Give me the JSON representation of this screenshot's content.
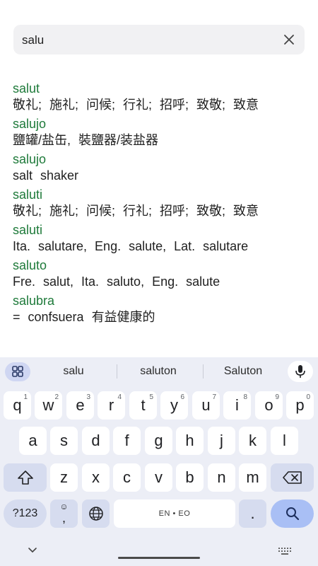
{
  "search": {
    "value": "salu",
    "placeholder": ""
  },
  "results": [
    {
      "head": "salut",
      "def": "敬礼;  施礼;  问候;  行礼;  招呼;  致敬;  致意"
    },
    {
      "head": "salujo",
      "def": "鹽罐/盐缶, 裝鹽器/装盐器"
    },
    {
      "head": "salujo",
      "def": "salt shaker"
    },
    {
      "head": "saluti",
      "def": "敬礼;  施礼;  问候;  行礼;  招呼;  致敬;  致意"
    },
    {
      "head": "saluti",
      "def": "Ita. salutare, Eng. salute, Lat. salutare"
    },
    {
      "head": "saluto",
      "def": "Fre. salut, Ita. saluto, Eng. salute"
    },
    {
      "head": "salubra",
      "def": "= confsuera 有益健康的"
    }
  ],
  "keyboard": {
    "suggestions": [
      "salu",
      "saluton",
      "Saluton"
    ],
    "row1": [
      {
        "k": "q",
        "h": "1"
      },
      {
        "k": "w",
        "h": "2"
      },
      {
        "k": "e",
        "h": "3"
      },
      {
        "k": "r",
        "h": "4"
      },
      {
        "k": "t",
        "h": "5"
      },
      {
        "k": "y",
        "h": "6"
      },
      {
        "k": "u",
        "h": "7"
      },
      {
        "k": "i",
        "h": "8"
      },
      {
        "k": "o",
        "h": "9"
      },
      {
        "k": "p",
        "h": "0"
      }
    ],
    "row2": [
      "a",
      "s",
      "d",
      "f",
      "g",
      "h",
      "j",
      "k",
      "l"
    ],
    "row3": [
      "z",
      "x",
      "c",
      "v",
      "b",
      "n",
      "m"
    ],
    "symbols_label": "?123",
    "comma_label": ",",
    "space_label": "EN • EO",
    "period_label": "."
  }
}
